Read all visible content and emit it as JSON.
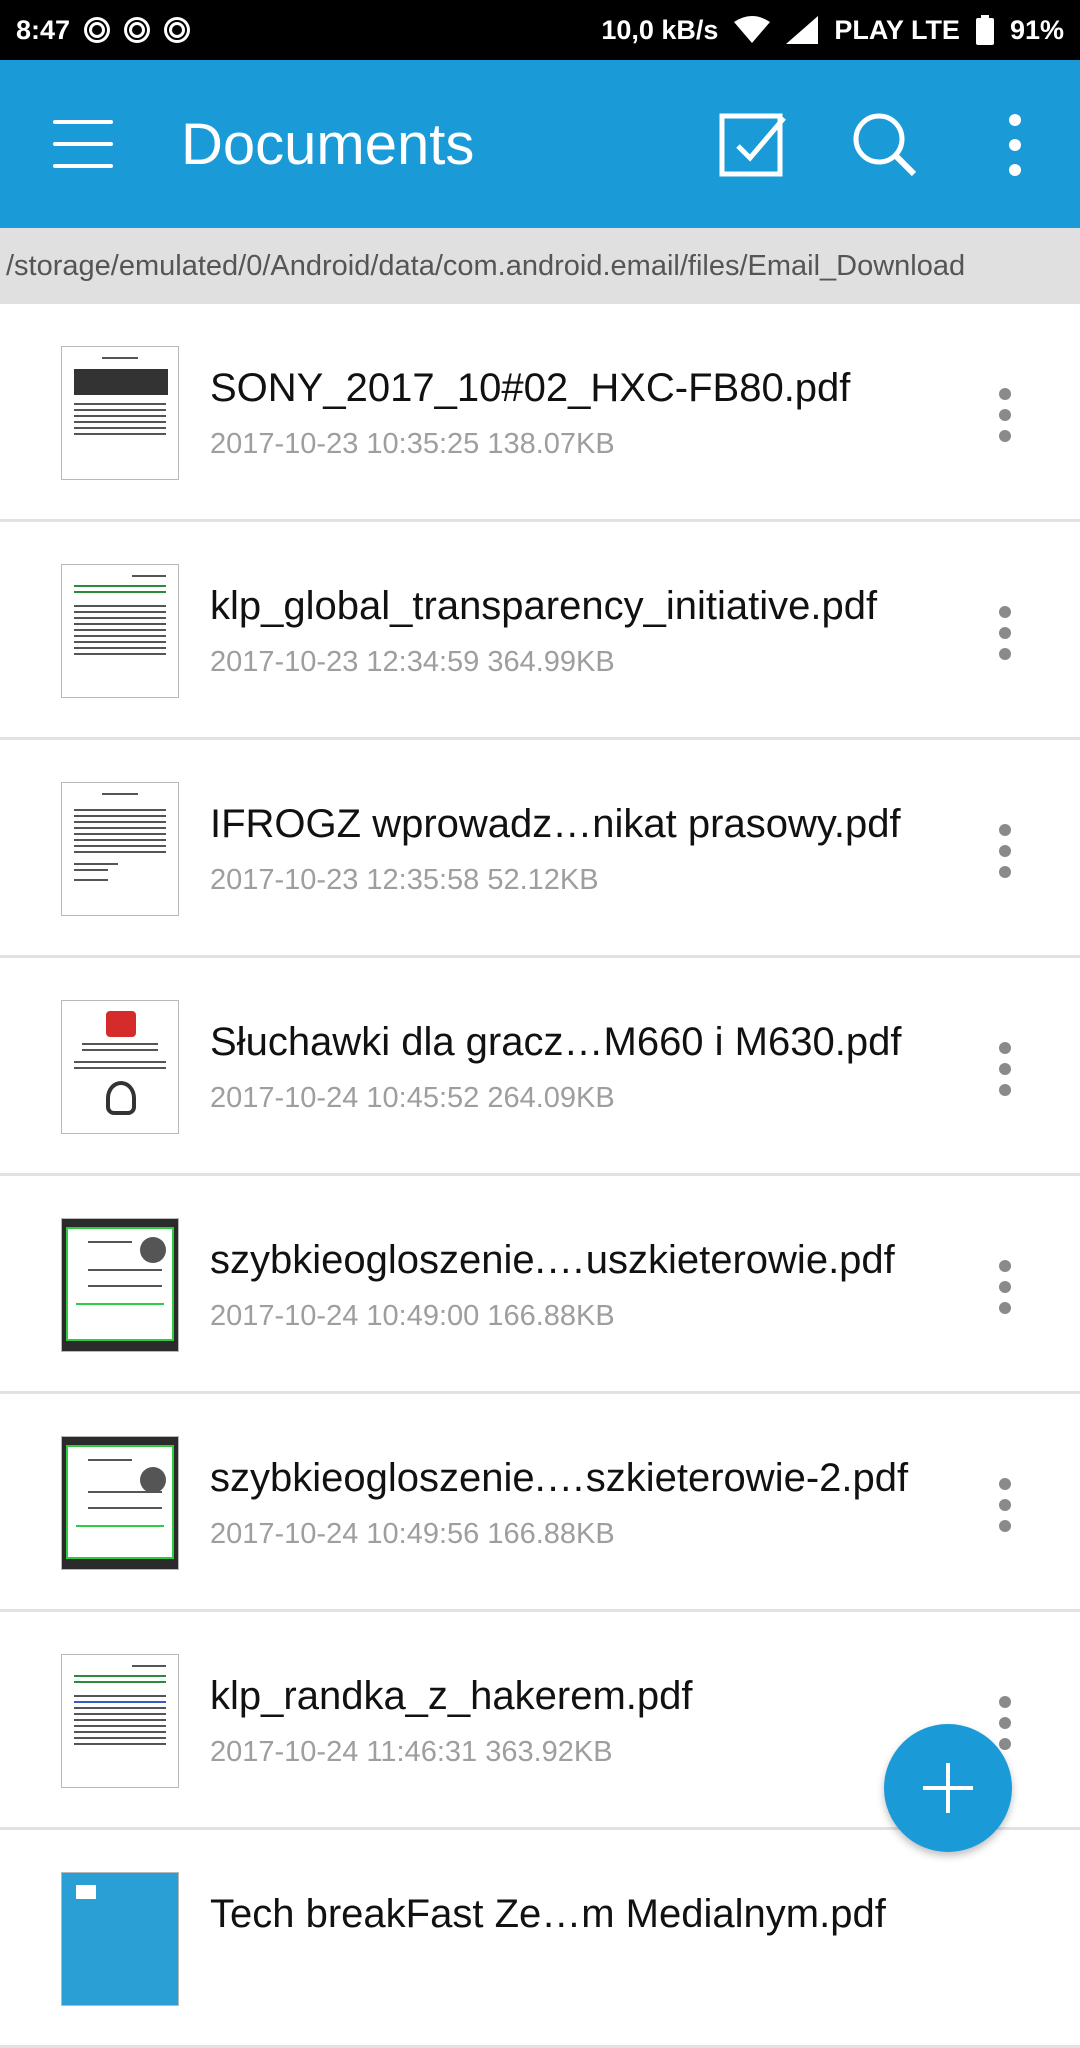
{
  "status_bar": {
    "time": "8:47",
    "notification_icons": [
      "g-icon",
      "image-icon",
      "instagram-icon"
    ],
    "speed": "10,0 kB/s",
    "carrier": "PLAY LTE",
    "battery": "91%"
  },
  "app_bar": {
    "title": "Documents",
    "actions": [
      "menu-icon",
      "select-icon",
      "search-icon",
      "more-icon"
    ],
    "color": "#1a9bd7"
  },
  "path": "/storage/emulated/0/Android/data/com.android.email/files/Email_Download",
  "files": [
    {
      "name": "SONY_2017_10#02_HXC-FB80.pdf",
      "meta": "2017-10-23 10:35:25 138.07KB",
      "thumb": "doc"
    },
    {
      "name": "klp_global_transparency_initiative.pdf",
      "meta": "2017-10-23 12:34:59 364.99KB",
      "thumb": "doc"
    },
    {
      "name": "IFROGZ wprowadz…nikat prasowy.pdf",
      "meta": "2017-10-23 12:35:58 52.12KB",
      "thumb": "doc"
    },
    {
      "name": "Słuchawki dla gracz…M660 i M630.pdf",
      "meta": "2017-10-24 10:45:52 264.09KB",
      "thumb": "doc"
    },
    {
      "name": "szybkieogloszenie.…uszkieterowie.pdf",
      "meta": "2017-10-24 10:49:00 166.88KB",
      "thumb": "green"
    },
    {
      "name": "szybkieogloszenie.…szkieterowie-2.pdf",
      "meta": "2017-10-24 10:49:56 166.88KB",
      "thumb": "green"
    },
    {
      "name": "klp_randka_z_hakerem.pdf",
      "meta": "2017-10-24 11:46:31 363.92KB",
      "thumb": "doc"
    },
    {
      "name": "Tech breakFast Ze…m Medialnym.pdf",
      "meta": "",
      "thumb": "blue"
    }
  ],
  "fab": {
    "icon": "plus-icon",
    "color": "#1a9bd7"
  }
}
